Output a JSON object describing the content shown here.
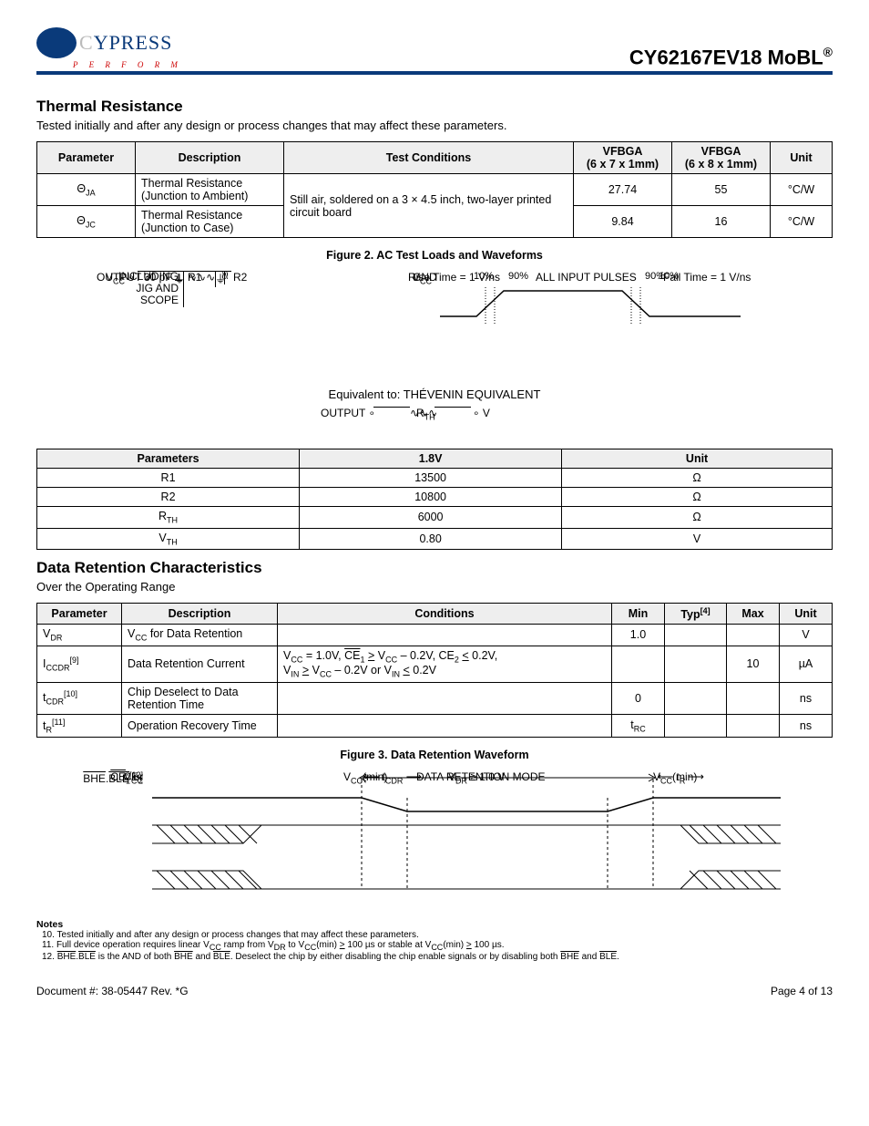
{
  "header": {
    "logo_text_light": "C",
    "logo_text_dark": "YPRESS",
    "perform": "P E R F O R M",
    "title": "CY62167EV18 MoBL",
    "title_tm": "®"
  },
  "thermal": {
    "title": "Thermal Resistance",
    "subtitle": "Tested initially and after any design or process changes that may affect these parameters.",
    "cols": {
      "param": "Parameter",
      "desc": "Description",
      "cond": "Test Conditions",
      "v1": "VFBGA",
      "v1s": "(6 x 7 x 1mm)",
      "v2": "VFBGA",
      "v2s": "(6 x 8 x 1mm)",
      "unit": "Unit"
    },
    "rows": [
      {
        "param_sym": "Θ",
        "param_sub": "JA",
        "desc": "Thermal Resistance (Junction to Ambient)",
        "cond": "Still air, soldered on a 3 × 4.5 inch, two-layer printed circuit board",
        "v1": "27.74",
        "v2": "55",
        "unit": "°C/W"
      },
      {
        "param_sym": "Θ",
        "param_sub": "JC",
        "desc": "Thermal Resistance (Junction to Case)",
        "cond": "",
        "v1": "9.84",
        "v2": "16",
        "unit": "°C/W"
      }
    ]
  },
  "figure2": {
    "caption": "Figure 2.  AC Test Loads and Waveforms",
    "circuit": {
      "vcc": "V",
      "vcc_sub": "CC",
      "output": "OUTPUT",
      "r1": "R1",
      "r2": "R2",
      "cap": "30 pF",
      "jig": "INCLUDING JIG AND SCOPE"
    },
    "wave": {
      "title": "ALL INPUT PULSES",
      "vcc": "V",
      "vcc_sub": "CC",
      "gnd": "GND",
      "p10": "10%",
      "p90": "90%",
      "rise": "Rise Time = 1 V/ns",
      "fall": "Fall Time = 1 V/ns"
    },
    "thevenin": {
      "eq": "Equivalent to: THÉVENIN EQUIVALENT",
      "output": "OUTPUT",
      "rth": "R",
      "rth_sub": "TH",
      "v": "V"
    }
  },
  "params_table": {
    "cols": {
      "param": "Parameters",
      "val": "1.8V",
      "unit": "Unit"
    },
    "rows": [
      {
        "param": "R1",
        "val": "13500",
        "unit": "Ω"
      },
      {
        "param": "R2",
        "val": "10800",
        "unit": "Ω"
      },
      {
        "param": "R",
        "param_sub": "TH",
        "val": "6000",
        "unit": "Ω"
      },
      {
        "param": "V",
        "param_sub": "TH",
        "val": "0.80",
        "unit": "V"
      }
    ]
  },
  "data_retention": {
    "title": "Data Retention Characteristics",
    "subtitle": "Over the Operating Range",
    "cols": {
      "param": "Parameter",
      "desc": "Description",
      "cond": "Conditions",
      "min": "Min",
      "typ": "Typ",
      "typ_ref": "[4]",
      "max": "Max",
      "unit": "Unit"
    },
    "rows": [
      {
        "param": "V",
        "param_sub": "DR",
        "ref": "",
        "desc_pre": "V",
        "desc_sub": "CC",
        "desc_post": " for Data Retention",
        "cond": "",
        "min": "1.0",
        "typ": "",
        "max": "",
        "unit": "V"
      },
      {
        "param": "I",
        "param_sub": "CCDR",
        "ref": "[9]",
        "desc": "Data Retention Current",
        "cond": "V_CC = 1.0V, CE_1 ≥ V_CC – 0.2V, CE_2 ≤ 0.2V, V_IN ≥ V_CC – 0.2V or V_IN ≤ 0.2V",
        "min": "",
        "typ": "",
        "max": "10",
        "unit": "µA"
      },
      {
        "param": "t",
        "param_sub": "CDR",
        "ref": "[10]",
        "desc": "Chip Deselect to Data Retention Time",
        "cond": "",
        "min": "0",
        "typ": "",
        "max": "",
        "unit": "ns"
      },
      {
        "param": "t",
        "param_sub": "R",
        "ref": "[11]",
        "desc": "Operation Recovery Time",
        "cond": "",
        "min": "t_RC",
        "typ": "",
        "max": "",
        "unit": "ns"
      }
    ]
  },
  "figure3": {
    "caption": "Figure 3.  Data Retention Waveform",
    "labels": {
      "vcc": "V",
      "vcc_sub": "CC",
      "ce1": "CE",
      "ce1_sub": "1",
      "bhe": "BHE",
      "ble": "BLE",
      "ref": "[12]",
      "or": "or",
      "ce2": "CE",
      "ce2_sub": "2",
      "vccmin": "V",
      "vccmin_sub": "CC",
      "vccmin_post": "(min)",
      "tcdr": "t",
      "tcdr_sub": "CDR",
      "tr": "t",
      "tr_sub": "R",
      "mode": "DATA RETENTION MODE",
      "vdr": "V",
      "vdr_sub": "DR",
      "vdr_post": " ≥ 1.0 V"
    }
  },
  "notes": {
    "title": "Notes",
    "items": [
      {
        "n": "10.",
        "text": "Tested initially and after any design or process changes that may affect these parameters."
      },
      {
        "n": "11.",
        "text": "Full device operation requires linear V_CC ramp from V_DR to V_CC(min) ≥ 100 µs or stable at V_CC(min) ≥ 100 µs."
      },
      {
        "n": "12.",
        "text": "BHE.BLE is the AND of both BHE and BLE. Deselect the chip by either disabling the chip enable signals or by disabling both BHE and BLE."
      }
    ]
  },
  "footer": {
    "doc": "Document #: 38-05447 Rev. *G",
    "page": "Page 4 of 13"
  }
}
